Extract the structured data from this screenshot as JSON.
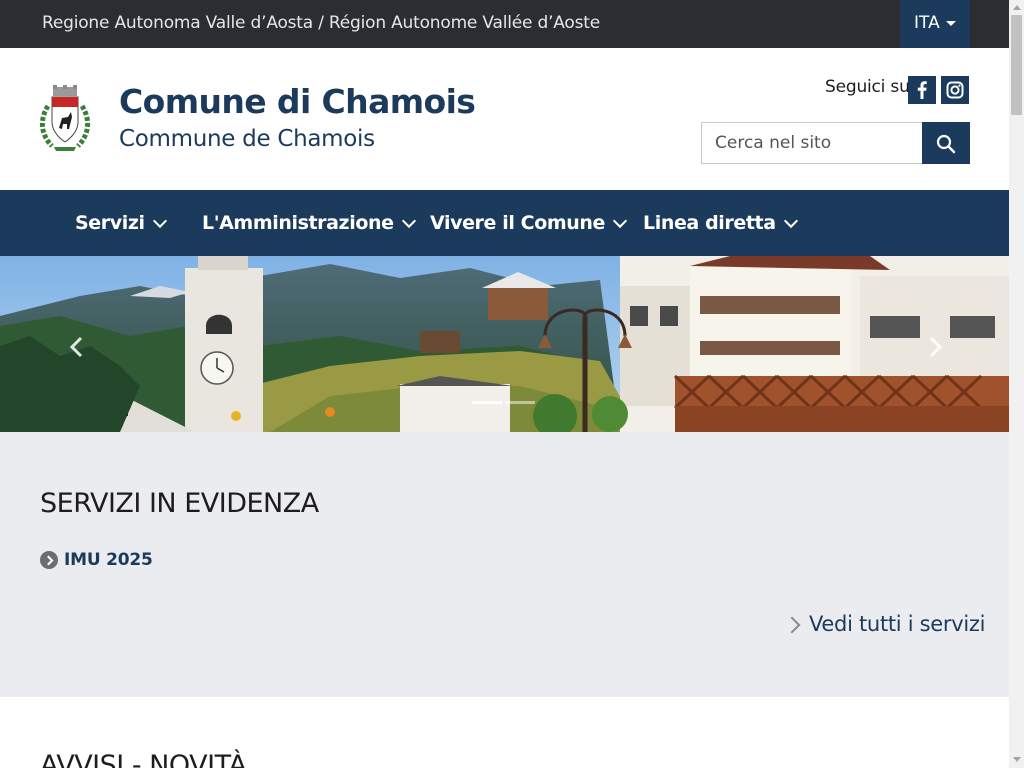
{
  "topbar": {
    "region": "Regione Autonoma Valle d’Aosta / Région Autonome Vallée d’Aoste",
    "language": "ITA"
  },
  "header": {
    "title": "Comune di Chamois",
    "subtitle": "Commune de Chamois",
    "follow_label": "Seguici su",
    "search_placeholder": "Cerca nel sito"
  },
  "nav": {
    "items": [
      {
        "label": "Servizi"
      },
      {
        "label": "L'Amministrazione"
      },
      {
        "label": "Vivere il Comune"
      },
      {
        "label": "Linea diretta"
      }
    ]
  },
  "carousel": {
    "slide_count": 2,
    "active_index": 0
  },
  "services": {
    "heading": "SERVIZI IN EVIDENZA",
    "items": [
      {
        "label": "IMU 2025"
      }
    ],
    "see_all": "Vedi tutti i servizi"
  },
  "news": {
    "heading": "AVVISI - NOVITÀ"
  },
  "colors": {
    "brand": "#1b3a5c",
    "topbar": "#2b2d33",
    "section_bg": "#ebecef"
  }
}
